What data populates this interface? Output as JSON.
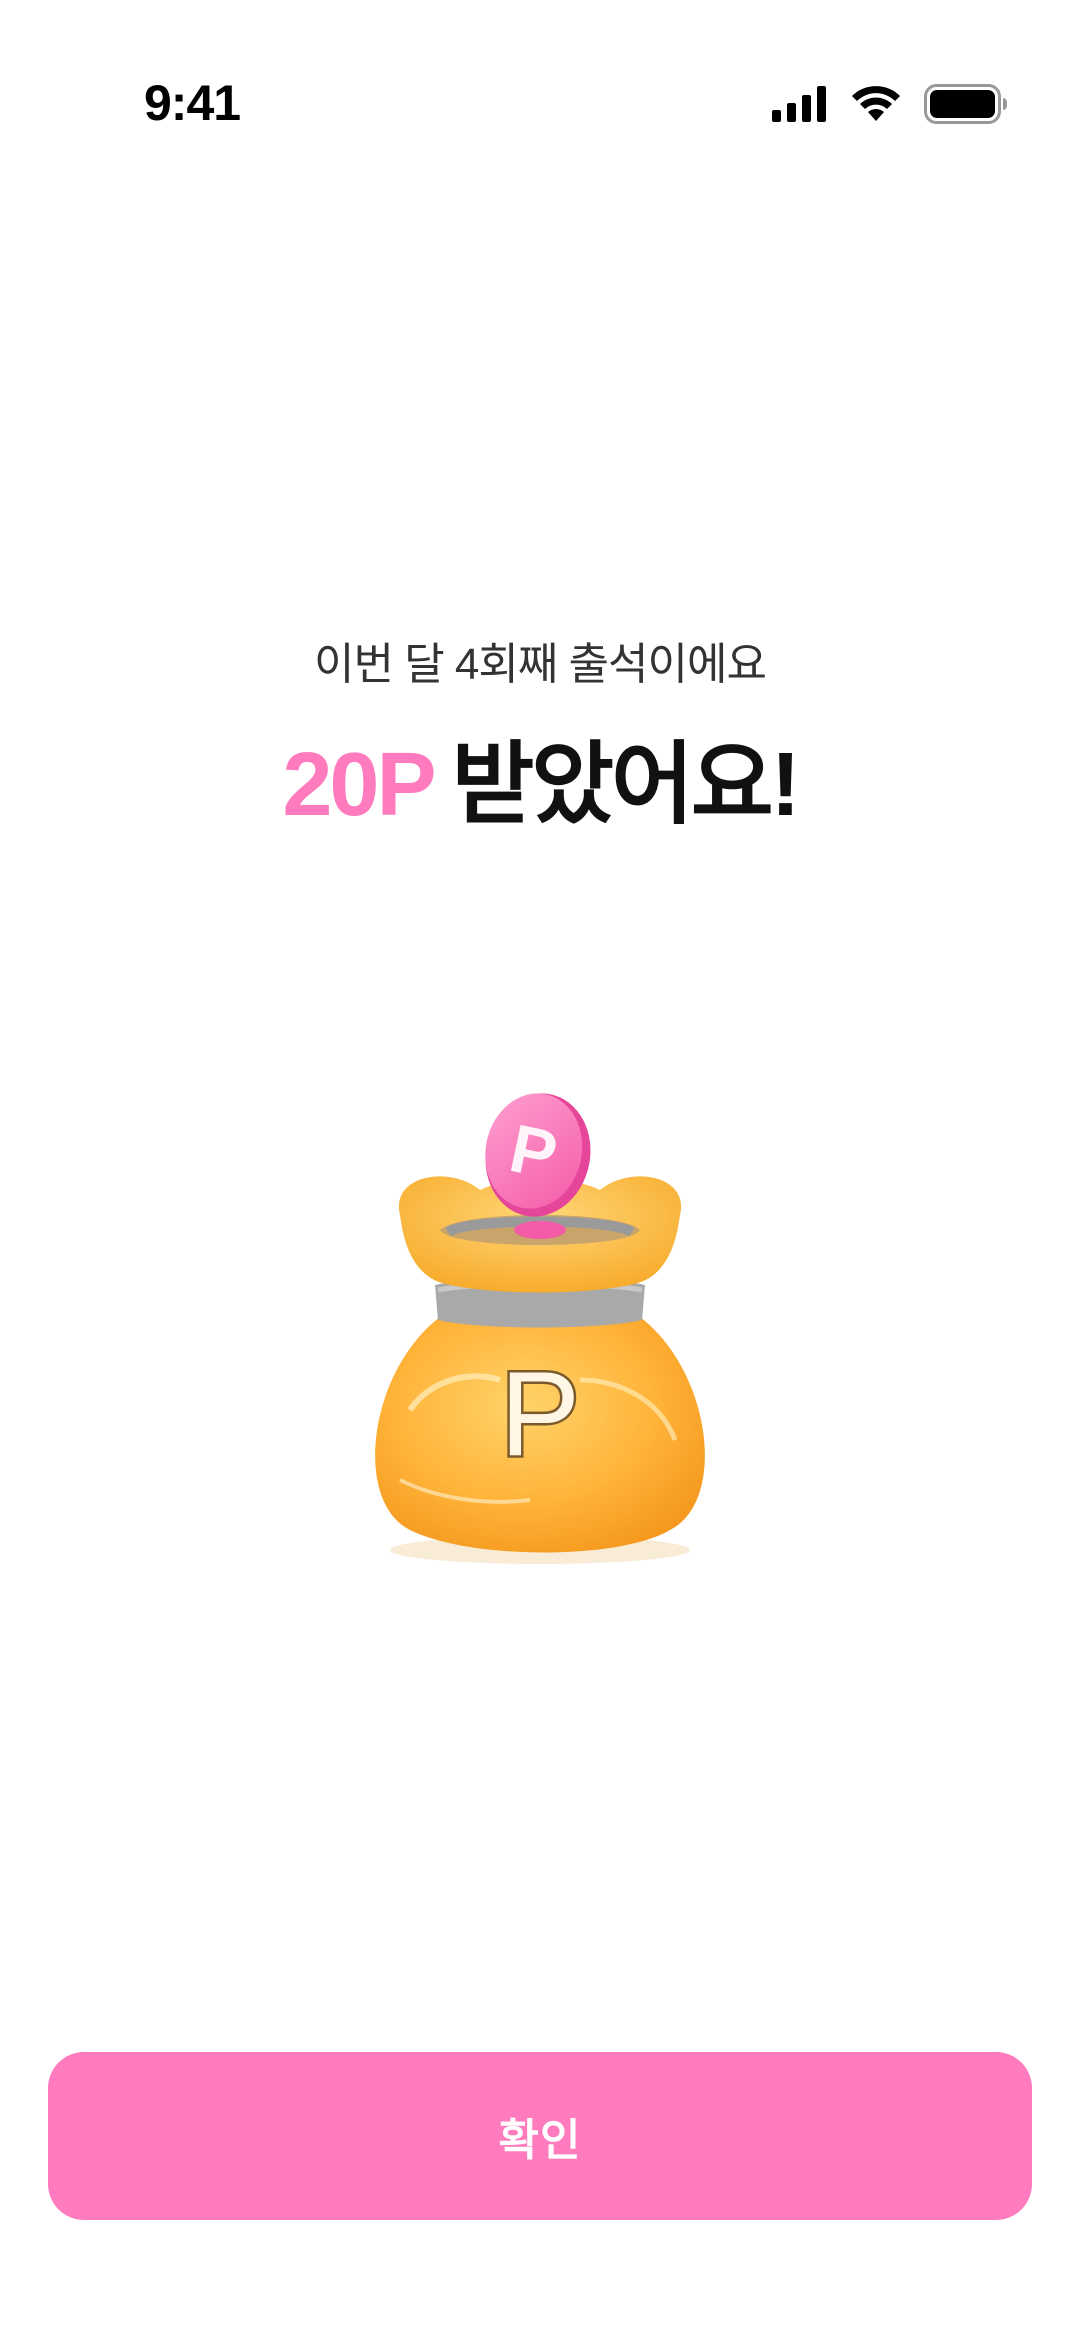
{
  "status_bar": {
    "time": "9:41",
    "icons": [
      "cellular-signal-icon",
      "wifi-icon",
      "battery-icon"
    ]
  },
  "reward": {
    "subtitle": "이번 달 4회째 출석이에요",
    "points": "20P",
    "title_rest": "받았어요!"
  },
  "illustration": {
    "name": "point-pouch-illustration",
    "coin_label": "P",
    "pouch_label": "P"
  },
  "confirm_button": {
    "label": "확인"
  },
  "colors": {
    "accent_pink": "#FF7BBE",
    "pouch_orange": "#FFB43A",
    "text_dark": "#111111",
    "text_sub": "#333333"
  }
}
